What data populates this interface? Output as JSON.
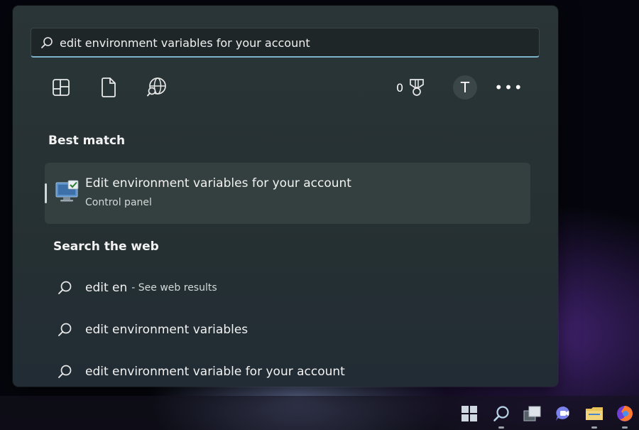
{
  "search": {
    "value": "edit environment variables for your account"
  },
  "toolbar": {
    "apps_icon": "apps-icon",
    "documents_icon": "document-icon",
    "web_icon": "globe-search-icon",
    "rewards_count": "0",
    "rewards_icon": "trophy-icon",
    "avatar_letter": "T",
    "more_label": "•••"
  },
  "best_match": {
    "heading": "Best match",
    "title": "Edit environment variables for your account",
    "subtitle": "Control panel",
    "icon": "control-panel-icon"
  },
  "web": {
    "heading": "Search the web",
    "items": [
      {
        "text": "edit en",
        "suffix": "- See web results"
      },
      {
        "text": "edit environment variables",
        "suffix": ""
      },
      {
        "text": "edit environment variable for your account",
        "suffix": ""
      }
    ]
  },
  "taskbar": {
    "icons": [
      "start-icon",
      "search-icon",
      "task-view-icon",
      "chat-icon",
      "file-explorer-icon",
      "firefox-icon"
    ]
  },
  "colors": {
    "panel": "#263133",
    "search_underline": "#7bb2c7",
    "selected_bg": "#34403f"
  }
}
